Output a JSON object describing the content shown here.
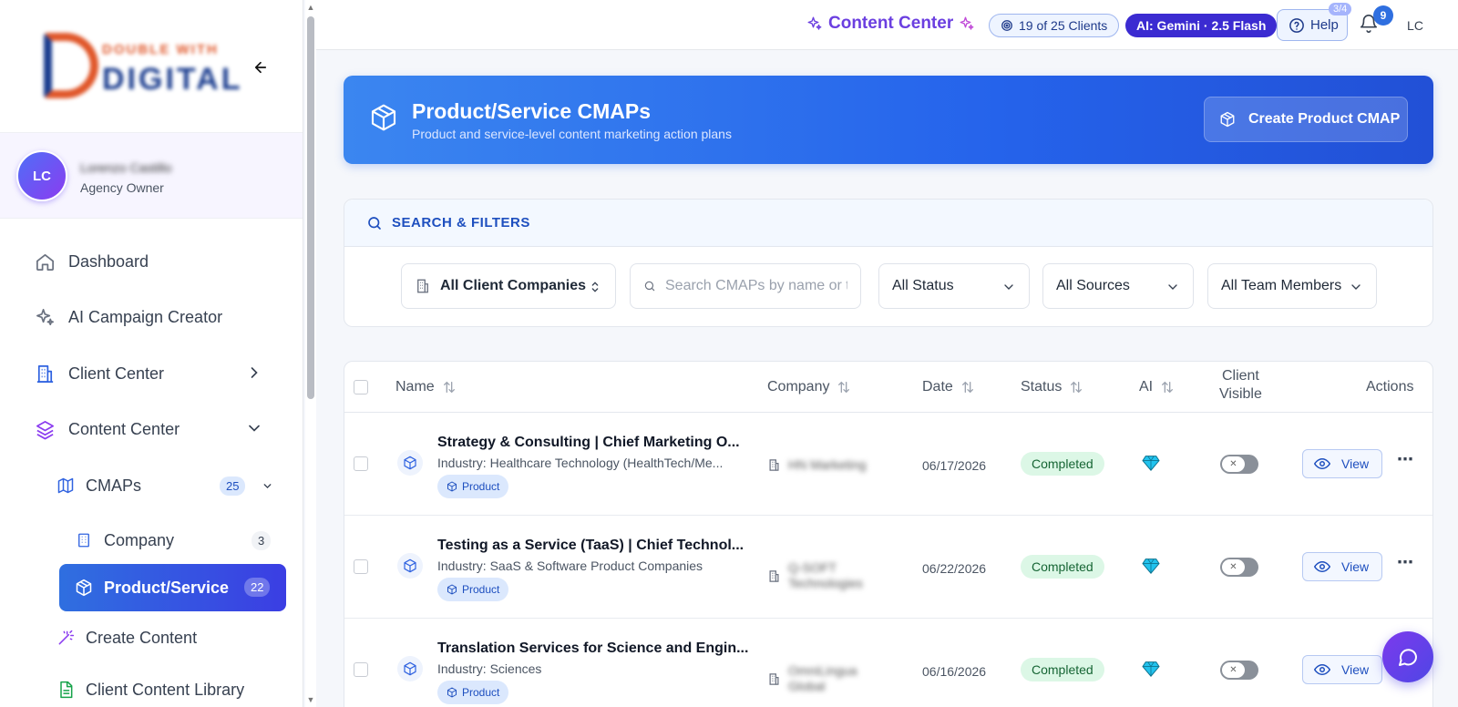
{
  "sidebar": {
    "user": {
      "initials": "LC",
      "name": "Lorenzo Castillo",
      "role": "Agency Owner"
    },
    "items": [
      {
        "label": "Dashboard"
      },
      {
        "label": "AI Campaign Creator"
      },
      {
        "label": "Client Center"
      },
      {
        "label": "Content Center"
      },
      {
        "label": "CMAPs",
        "count": "25"
      },
      {
        "label": "Company",
        "count": "3"
      },
      {
        "label": "Product/Service",
        "count": "22"
      },
      {
        "label": "Create Content"
      },
      {
        "label": "Client Content Library"
      }
    ],
    "logo_text_top": "DOUBLE WITH",
    "logo_text_bottom": "DIGITAL"
  },
  "topbar": {
    "title": "Content Center",
    "clients_pill": "19 of 25 Clients",
    "ai_pill": "AI: Gemini · 2.5 Flash",
    "help_label": "Help",
    "help_badge": "3/4",
    "notif_count": "9",
    "avatar": "LC"
  },
  "hero": {
    "title": "Product/Service CMAPs",
    "subtitle": "Product and service-level content marketing action plans",
    "button": "Create Product CMAP"
  },
  "filters": {
    "heading": "SEARCH & FILTERS",
    "company": "All Client Companies",
    "search_placeholder": "Search CMAPs by name or tags",
    "status": "All Status",
    "sources": "All Sources",
    "team": "All Team Members"
  },
  "table": {
    "columns": {
      "name": "Name",
      "company": "Company",
      "date": "Date",
      "status": "Status",
      "ai": "AI",
      "client_visible_1": "Client",
      "client_visible_2": "Visible",
      "actions": "Actions"
    },
    "rows": [
      {
        "title": "Strategy & Consulting | Chief Marketing O...",
        "industry": "Industry: Healthcare Technology (HealthTech/Me...",
        "tag": "Product",
        "company": "HN Marketing",
        "date": "06/17/2026",
        "status": "Completed",
        "view": "View"
      },
      {
        "title": "Testing as a Service (TaaS) | Chief Technol...",
        "industry": "Industry: SaaS & Software Product Companies",
        "tag": "Product",
        "company": "Q-SOFT Technologies",
        "date": "06/22/2026",
        "status": "Completed",
        "view": "View"
      },
      {
        "title": "Translation Services for Science and Engin...",
        "industry": "Industry: Sciences",
        "tag": "Product",
        "company": "OmniLingua Global",
        "date": "06/16/2026",
        "status": "Completed",
        "view": "View"
      }
    ]
  },
  "colors": {
    "primary": "#2563eb",
    "accent": "#6b3fe0",
    "success": "#dcf7e6",
    "active_nav": "#3150e6"
  }
}
